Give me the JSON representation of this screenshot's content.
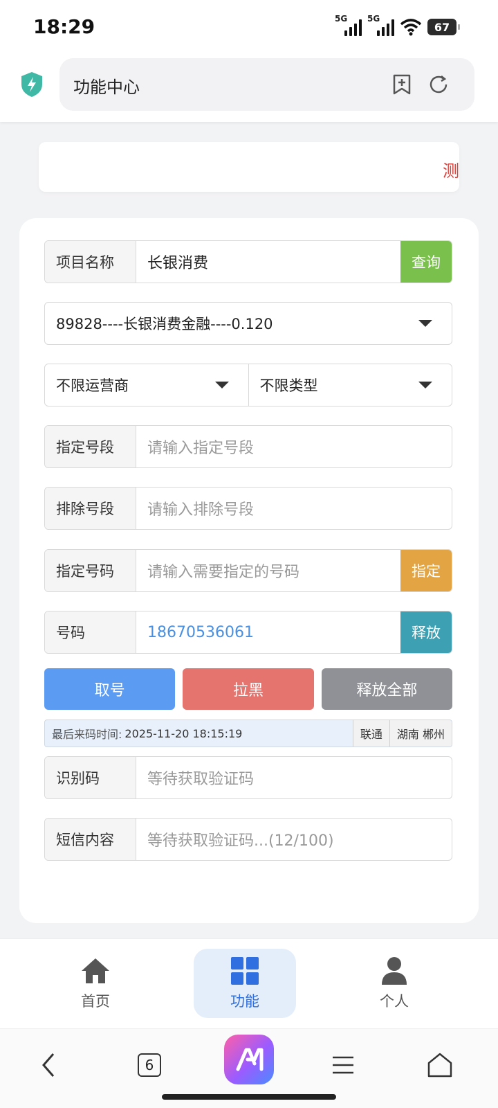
{
  "status_bar": {
    "time": "18:29",
    "network1": "5G",
    "network2": "5G",
    "battery": "67"
  },
  "browser": {
    "title": "功能中心",
    "icons": [
      "shield-icon",
      "bookmark-add-icon",
      "reload-icon"
    ]
  },
  "marquee": {
    "text": "测"
  },
  "form": {
    "project": {
      "label": "项目名称",
      "value": "长银消费",
      "button": "查询"
    },
    "project_select": {
      "value": "89828----长银消费金融----0.120"
    },
    "operator_select": {
      "value": "不限运营商"
    },
    "type_select": {
      "value": "不限类型"
    },
    "specify_prefix": {
      "label": "指定号段",
      "placeholder": "请输入指定号段"
    },
    "exclude_prefix": {
      "label": "排除号段",
      "placeholder": "请输入排除号段"
    },
    "specify_number": {
      "label": "指定号码",
      "placeholder": "请输入需要指定的号码",
      "button": "指定"
    },
    "number": {
      "label": "号码",
      "value": "18670536061",
      "button": "释放"
    },
    "actions": {
      "get": "取号",
      "block": "拉黑",
      "release_all": "释放全部"
    },
    "last_code": {
      "label": "最后来码时间:",
      "time": "2025-11-20 18:15:19",
      "carrier": "联通",
      "region": "湖南 郴州"
    },
    "code": {
      "label": "识别码",
      "placeholder": "等待获取验证码"
    },
    "sms": {
      "label": "短信内容",
      "placeholder": "等待获取验证码...(12/100)"
    }
  },
  "tabbar": {
    "home": "首页",
    "features": "功能",
    "profile": "个人"
  },
  "navbar": {
    "tabs_count": "6"
  },
  "colors": {
    "query_button": "#79c04d",
    "specify_button": "#e3a444",
    "release_button": "#3da0b3",
    "get_button": "#5b9cf2",
    "block_button": "#e5736e",
    "release_all_button": "#8f9196",
    "active_tab": "#2f6fe0",
    "marquee_text": "#d9403a"
  }
}
